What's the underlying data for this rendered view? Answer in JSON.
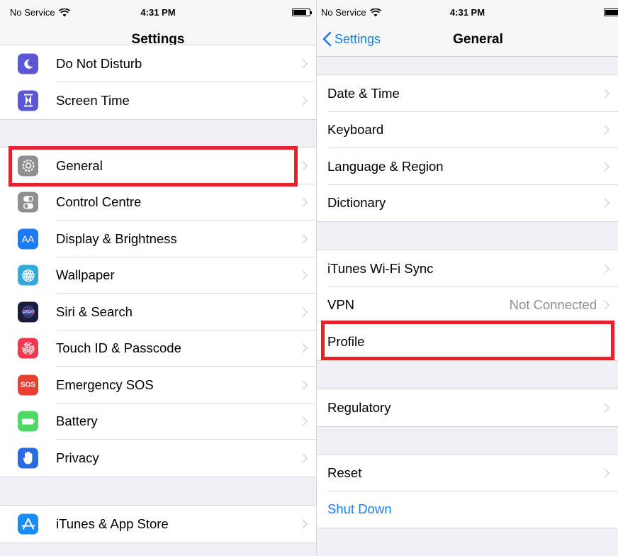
{
  "left": {
    "status": {
      "carrier": "No Service",
      "time": "4:31 PM"
    },
    "nav_title": "Settings",
    "group1": [
      {
        "label": "Do Not Disturb",
        "icon": "moon-icon",
        "color": "#5b57d6"
      },
      {
        "label": "Screen Time",
        "icon": "hourglass-icon",
        "color": "#5b57d6"
      }
    ],
    "group2": [
      {
        "label": "General",
        "icon": "gear-icon",
        "color": "#8e8e93"
      },
      {
        "label": "Control Centre",
        "icon": "switches-icon",
        "color": "#8e8e93"
      },
      {
        "label": "Display & Brightness",
        "icon": "text-size-icon",
        "glyph": "AA",
        "color": "#1a7cf5"
      },
      {
        "label": "Wallpaper",
        "icon": "flower-icon",
        "color": "#34aadc"
      },
      {
        "label": "Siri & Search",
        "icon": "siri-icon",
        "color": "#1b1b3a"
      },
      {
        "label": "Touch ID & Passcode",
        "icon": "fingerprint-icon",
        "color": "#f0384e"
      },
      {
        "label": "Emergency SOS",
        "icon": "sos-icon",
        "glyph": "SOS",
        "color": "#e94034"
      },
      {
        "label": "Battery",
        "icon": "battery-icon",
        "color": "#4cd964"
      },
      {
        "label": "Privacy",
        "icon": "hand-icon",
        "color": "#2a6be0"
      }
    ],
    "group3": [
      {
        "label": "iTunes & App Store",
        "icon": "app-store-icon",
        "color": "#1a8cf5"
      }
    ]
  },
  "right": {
    "status": {
      "carrier": "No Service",
      "time": "4:31 PM"
    },
    "back_label": "Settings",
    "nav_title": "General",
    "group1": [
      "Date & Time",
      "Keyboard",
      "Language & Region",
      "Dictionary"
    ],
    "group2": [
      {
        "label": "iTunes Wi-Fi Sync"
      },
      {
        "label": "VPN",
        "detail": "Not Connected"
      },
      {
        "label": "Profile"
      }
    ],
    "group3": [
      "Regulatory"
    ],
    "group4": {
      "reset": "Reset",
      "shutdown": "Shut Down"
    }
  },
  "colors": {
    "highlight": "#e8202a",
    "ios_blue": "#1a7cf5"
  }
}
